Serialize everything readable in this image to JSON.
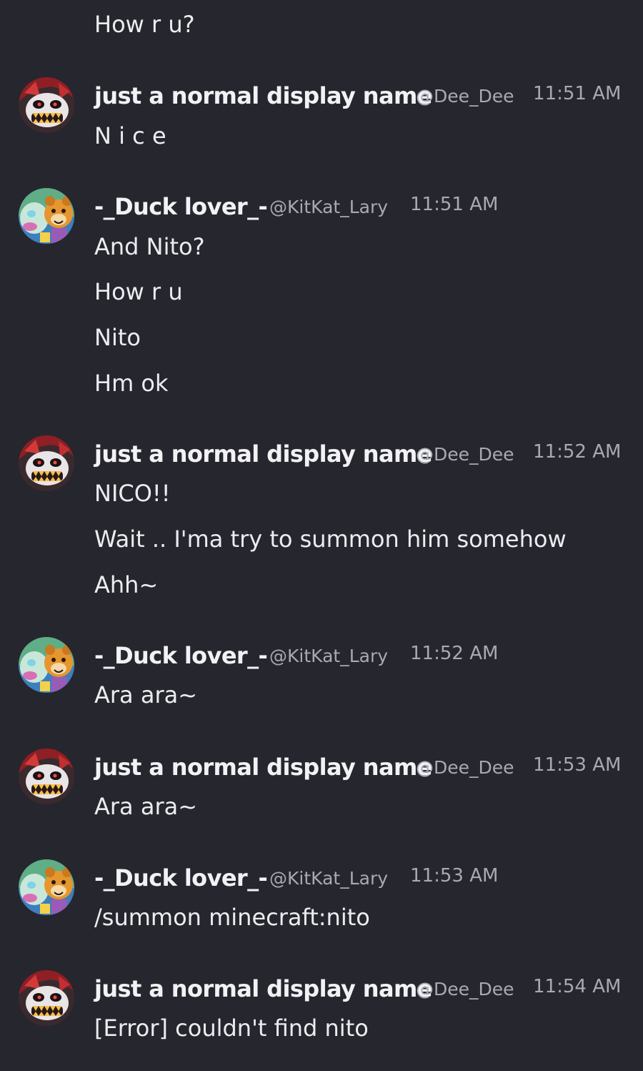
{
  "users": {
    "dee": {
      "display_name": "just a normal display name",
      "handle": "@Dee_Dee",
      "avatar_icon": "red-black-animatronic-avatar-icon"
    },
    "lary": {
      "display_name": "-_Duck lover_-",
      "handle": "@KitKat_Lary",
      "avatar_icon": "animatronic-bear-duck-avatar-icon"
    }
  },
  "messages": [
    {
      "continuation": true,
      "lines": [
        "How r u?"
      ]
    },
    {
      "user": "dee",
      "time": "11:51 AM",
      "lines": [
        "N i c e"
      ]
    },
    {
      "user": "lary",
      "time": "11:51 AM",
      "lines": [
        "And Nito?",
        "How r u",
        "Nito",
        "Hm ok"
      ]
    },
    {
      "user": "dee",
      "time": "11:52 AM",
      "lines": [
        "NICO!!",
        "Wait .. I'ma try to summon him somehow",
        "Ahh~"
      ]
    },
    {
      "user": "lary",
      "time": "11:52 AM",
      "lines": [
        "Ara ara~"
      ]
    },
    {
      "user": "dee",
      "time": "11:53 AM",
      "lines": [
        "Ara ara~"
      ]
    },
    {
      "user": "lary",
      "time": "11:53 AM",
      "lines": [
        "/summon minecraft:nito"
      ]
    },
    {
      "user": "dee",
      "time": "11:54 AM",
      "lines": [
        "[Error] couldn't find nito"
      ]
    }
  ],
  "colors": {
    "background": "#26262f",
    "message_text": "#ececf0",
    "display_name": "#f2f2f5",
    "muted": "#a9a9b3"
  }
}
